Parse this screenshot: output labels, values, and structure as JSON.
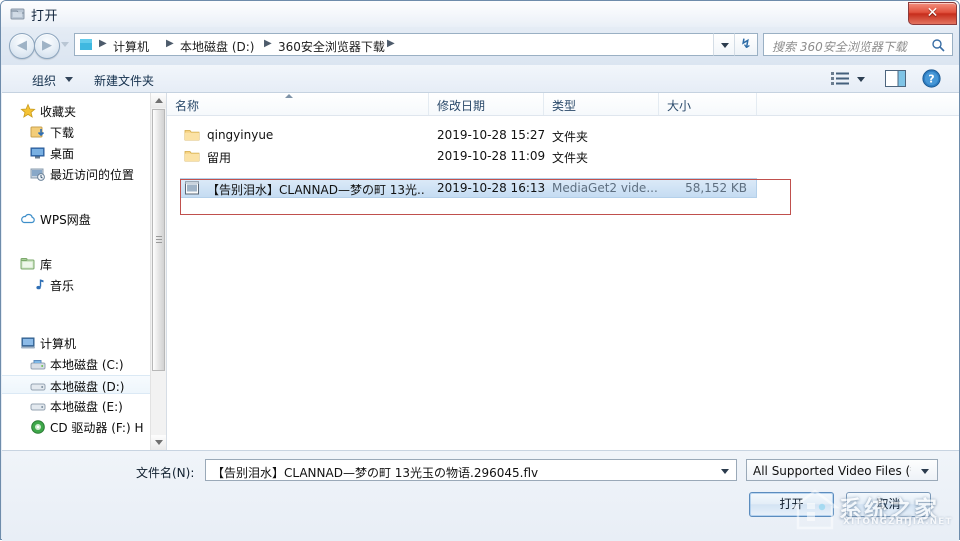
{
  "window": {
    "title": "打开",
    "title_icon": "open-folder-icon",
    "close_label": "✕"
  },
  "nav": {
    "back_icon": "back-arrow-icon",
    "forward_icon": "forward-arrow-icon",
    "history_icon": "chevron-down-icon",
    "refresh_icon": "refresh-icon",
    "address_dropdown_icon": "chevron-down-icon",
    "breadcrumbs": [
      {
        "label": "计算机"
      },
      {
        "label": "本地磁盘 (D:)"
      },
      {
        "label": "360安全浏览器下载"
      }
    ],
    "separator": "▶"
  },
  "search": {
    "placeholder": "搜索 360安全浏览器下载",
    "icon": "search-icon"
  },
  "commandbar": {
    "organize_label": "组织",
    "new_folder_label": "新建文件夹",
    "view_icon": "view-list-icon",
    "preview_icon": "preview-pane-icon",
    "help_icon": "help-icon"
  },
  "sidebar": {
    "groups": [
      {
        "header": "收藏夹",
        "icon": "star-icon",
        "items": [
          {
            "label": "下载",
            "icon": "downloads-icon"
          },
          {
            "label": "桌面",
            "icon": "desktop-icon"
          },
          {
            "label": "最近访问的位置",
            "icon": "recent-places-icon"
          }
        ]
      },
      {
        "header": "WPS网盘",
        "icon": "cloud-icon",
        "items": []
      },
      {
        "header": "库",
        "icon": "library-icon",
        "items": [
          {
            "label": "音乐",
            "icon": "music-icon"
          }
        ]
      },
      {
        "header": "计算机",
        "icon": "computer-icon",
        "items": [
          {
            "label": "本地磁盘 (C:)",
            "icon": "system-drive-icon"
          },
          {
            "label": "本地磁盘 (D:)",
            "icon": "drive-icon",
            "selected": true
          },
          {
            "label": "本地磁盘 (E:)",
            "icon": "drive-icon"
          },
          {
            "label": "CD 驱动器 (F:) H",
            "icon": "cd-drive-icon"
          }
        ]
      }
    ],
    "scrollbar": {
      "up_icon": "scroll-up-icon",
      "down_icon": "scroll-down-icon"
    }
  },
  "filelist": {
    "columns": [
      {
        "label": "名称"
      },
      {
        "label": "修改日期"
      },
      {
        "label": "类型"
      },
      {
        "label": "大小"
      }
    ],
    "sort_icon": "sort-ascending-icon",
    "rows": [
      {
        "name": "qingyinyue",
        "date": "2019-10-28 15:27",
        "type": "文件夹",
        "size": "",
        "icon": "folder-icon",
        "selected": false
      },
      {
        "name": "留用",
        "date": "2019-10-28 11:09",
        "type": "文件夹",
        "size": "",
        "icon": "folder-icon",
        "selected": false
      },
      {
        "name": "【告别泪水】CLANNAD—梦の町 13光...",
        "date": "2019-10-28 16:13",
        "type": "MediaGet2 vide...",
        "size": "58,152 KB",
        "icon": "video-file-icon",
        "selected": true
      }
    ]
  },
  "annotation": {
    "color": "#c0504d"
  },
  "bottom": {
    "filename_label": "文件名(N):",
    "filename_value": "【告别泪水】CLANNAD—梦の町 13光玉の物语.296045.flv",
    "filter_value": "All Supported Video Files (*.",
    "open_label": "打开",
    "cancel_label": "取消"
  },
  "watermark": {
    "text": "系统之家",
    "subtext": "XITONGZHIJIA.NET"
  },
  "colors": {
    "accent": "#2b4a6b",
    "selection": "#c5dcf2",
    "annotation": "#c0504d",
    "close_button": "#c62d1c"
  }
}
